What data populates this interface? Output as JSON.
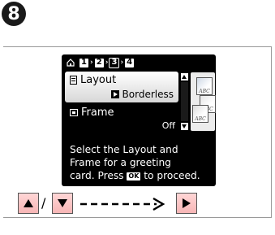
{
  "step_number": "8",
  "lcd": {
    "steps": [
      "1",
      "2",
      "3",
      "4"
    ],
    "active_step": "3",
    "menu": {
      "item1_label": "Layout",
      "item1_value": "Borderless",
      "item2_label": "Frame",
      "item2_value": "Off"
    },
    "preview_cards": [
      "ABC",
      "ABC",
      "ABC"
    ],
    "message_line1": "Select the Layout and",
    "message_line2": "Frame for a greeting",
    "message_line3_before": "card. Press",
    "ok_key_label": "OK",
    "message_line3_after": "to proceed."
  },
  "controls": {
    "separator": "/"
  },
  "colors": {
    "lcd_background": "#000000",
    "button_fill": "#f7b6b6",
    "selection_highlight": "#ffffff"
  },
  "icons": {
    "home": "home-icon",
    "layout": "layout-icon",
    "frame": "frame-icon",
    "up": "up-arrow-icon",
    "down": "down-arrow-icon",
    "right": "right-arrow-icon"
  }
}
